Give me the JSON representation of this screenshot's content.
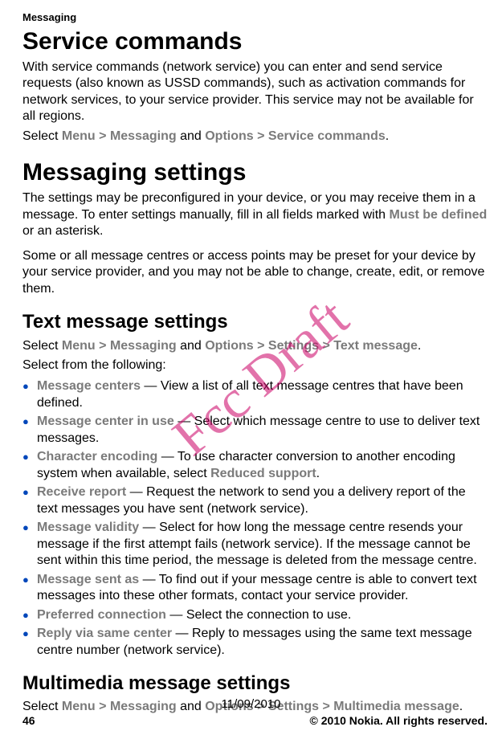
{
  "header": {
    "section": "Messaging"
  },
  "watermark": "Fcc Draft",
  "h1_a": "Service commands",
  "p1": "With service commands (network service) you can enter and send service requests (also known as USSD commands), such as activation commands for network services, to your service provider. This service may not be available for all regions.",
  "p2_pre": "Select ",
  "p2_menu": "Menu",
  "p2_gt1": " > ",
  "p2_msg": "Messaging",
  "p2_and": " and ",
  "p2_opt": "Options",
  "p2_gt2": " > ",
  "p2_sc": "Service commands",
  "p2_end": ".",
  "h1_b": "Messaging settings",
  "p3_a": "The settings may be preconfigured in your device, or you may receive them in a message. To enter settings manually, fill in all fields marked with ",
  "p3_mbd": "Must be defined",
  "p3_b": " or an asterisk.",
  "p4": "Some or all message centres or access points may be preset for your device by your service provider, and you may not be able to change, create, edit, or remove them.",
  "h2_a": "Text message settings",
  "p5_pre": "Select ",
  "p5_menu": "Menu",
  "p5_gt1": " > ",
  "p5_msg": "Messaging",
  "p5_and": " and ",
  "p5_opt": "Options",
  "p5_gt2": " > ",
  "p5_set": "Settings",
  "p5_gt3": " > ",
  "p5_tm": "Text message",
  "p5_end": ".",
  "p6": "Select from the following:",
  "items": [
    {
      "label": "Message centers",
      "text": " — View a list of all text message centres that have been defined."
    },
    {
      "label": "Message center in use",
      "text": " — Select which message centre to use to deliver text messages."
    },
    {
      "label": "Character encoding",
      "text_a": " — To use character conversion to another encoding system when available, select ",
      "label2": "Reduced support",
      "text_b": "."
    },
    {
      "label": "Receive report",
      "text": " — Request the network to send you a delivery report of the text messages you have sent (network service)."
    },
    {
      "label": "Message validity",
      "text": " — Select for how long the message centre resends your message if the first attempt fails (network service). If the message cannot be sent within this time period, the message is deleted from the message centre."
    },
    {
      "label": "Message sent as",
      "text": " — To find out if your message centre is able to convert text messages into these other formats, contact your service provider."
    },
    {
      "label": "Preferred connection",
      "text": " — Select the connection to use."
    },
    {
      "label": "Reply via same center",
      "text": " — Reply to messages using the same text message centre number (network service)."
    }
  ],
  "h2_b": "Multimedia message settings",
  "p7_pre": "Select ",
  "p7_menu": "Menu",
  "p7_gt1": " > ",
  "p7_msg": "Messaging",
  "p7_and": " and ",
  "p7_opt": "Options",
  "p7_gt2": " > ",
  "p7_set": "Settings",
  "p7_gt3": " > ",
  "p7_mm": "Multimedia message",
  "p7_end": ".",
  "date": "11/09/2010",
  "footer": {
    "page": "46",
    "copyright": "© 2010 Nokia. All rights reserved."
  }
}
